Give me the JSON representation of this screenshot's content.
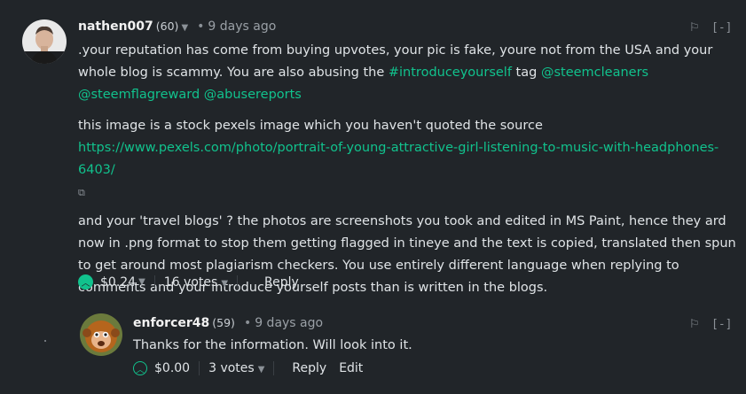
{
  "comment1": {
    "author": "nathen007",
    "reputation": "(60)",
    "separator_dot": "•",
    "time": "9 days ago",
    "collapse_label": "[-]",
    "para1_text": ".your reputation has come from buying upvotes, your pic is fake, youre not from the USA and your whole blog is scammy. You are also abusing the ",
    "tag_link": "#introduceyourself",
    "para1_mid": " tag ",
    "mention1": "@steemcleaners",
    "mention2": "@steemflagreward",
    "mention3": "@abusereports",
    "para2_text": "this image is a stock pexels image which you haven't quoted the source",
    "url": "https://www.pexels.com/photo/portrait-of-young-attractive-girl-listening-to-music-with-headphones-6403/",
    "para3_text": "and your 'travel blogs' ? the photos are screenshots you took and edited in MS Paint, hence they ard now in .png format to stop them getting flagged in tineye and the text is copied, translated then spun to get around most plagiarism checkers. You use entirely different language when replying to comments and your introduce yourself posts than is written in the blogs.",
    "payout": "$0.24",
    "votes": "16 votes",
    "reply_label": "Reply"
  },
  "comment2": {
    "author": "enforcer48",
    "reputation": "(59)",
    "separator_dot": "•",
    "time": "9 days ago",
    "collapse_label": "[-]",
    "body": "Thanks for the information. Will look into it.",
    "payout": "$0.00",
    "votes": "3 votes",
    "reply_label": "Reply",
    "edit_label": "Edit"
  },
  "icons": {
    "upvote": "chevron-up-icon",
    "flag": "flag-icon",
    "caret": "caret-down-icon",
    "external": "external-link-icon"
  },
  "colors": {
    "background": "#212529",
    "accent": "#11c28d",
    "text": "#dfe3e6"
  }
}
